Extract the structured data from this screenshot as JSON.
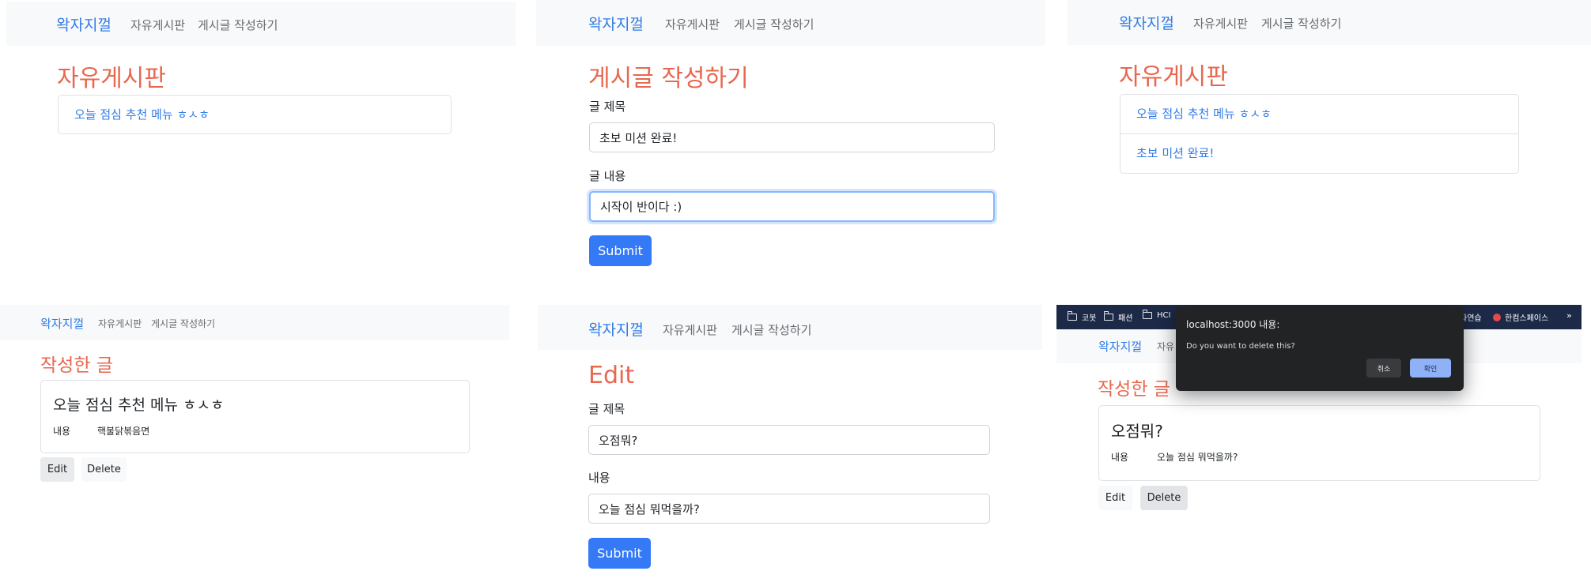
{
  "nav": {
    "brand": "왁자지껄",
    "board_link": "자유게시판",
    "write_link": "게시글 작성하기"
  },
  "panel_list_1": {
    "title": "자유게시판",
    "posts": [
      "오늘 점심 추천 메뉴 ㅎㅅㅎ"
    ]
  },
  "panel_write": {
    "title": "게시글 작성하기",
    "title_label": "글 제목",
    "title_value": "초보 미션 완료!",
    "content_label": "글 내용",
    "content_value": "시작이 반이다 :)",
    "submit": "Submit"
  },
  "panel_list_2": {
    "title": "자유게시판",
    "posts": [
      "오늘 점심 추천 메뉴 ㅎㅅㅎ",
      "초보 미션 완료!"
    ]
  },
  "panel_detail": {
    "title": "작성한 글",
    "post_title": "오늘 점심 추천 메뉴 ㅎㅅㅎ",
    "content_key": "내용",
    "content_value": "핵불닭볶음면",
    "edit": "Edit",
    "delete": "Delete"
  },
  "panel_edit": {
    "title": "Edit",
    "title_label": "글 제목",
    "title_value": "오점뭐?",
    "content_label": "내용",
    "content_value": "오늘 점심 뭐먹을까?",
    "submit": "Submit"
  },
  "panel_delete": {
    "bookmarks": [
      "코봇",
      "패션",
      "HCI",
      "자연습",
      "한컴스페이스"
    ],
    "bookmarks_more": "»",
    "nav_partial": "자유",
    "title": "작성한 글",
    "post_title": "오점뭐?",
    "content_key": "내용",
    "content_value": "오늘 점심 뭐먹을까?",
    "edit": "Edit",
    "delete": "Delete",
    "dialog": {
      "origin": "localhost:3000 내용:",
      "message": "Do you want to delete this?",
      "cancel": "취소",
      "ok": "확인"
    }
  },
  "colors": {
    "link": "#2f7be8",
    "heading": "#e8674f",
    "primary": "#3479f6",
    "navbar_bg": "#f8f9fa",
    "bookmark_bar": "#1d2a47"
  }
}
